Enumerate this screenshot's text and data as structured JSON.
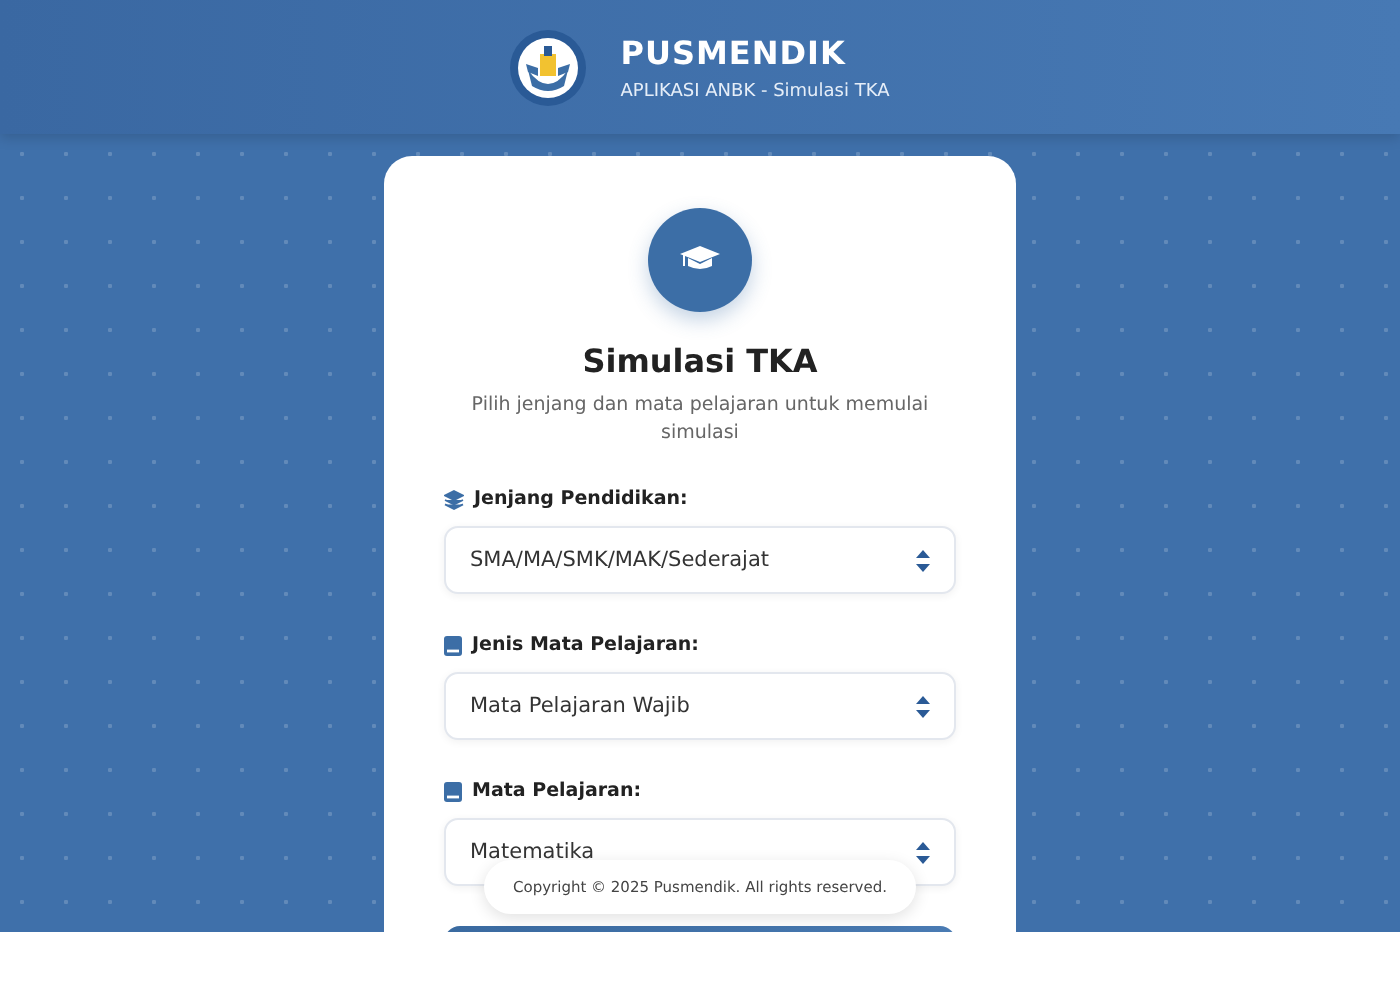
{
  "header": {
    "title": "PUSMENDIK",
    "subtitle": "APLIKASI ANBK - Simulasi TKA"
  },
  "card": {
    "title": "Simulasi TKA",
    "description": "Pilih jenjang dan mata pelajaran untuk memulai simulasi",
    "fields": [
      {
        "kind": "layers",
        "label": "Jenjang Pendidikan:",
        "value": "SMA/MA/SMK/MAK/Sederajat"
      },
      {
        "kind": "book",
        "label": "Jenis Mata Pelajaran:",
        "value": "Mata Pelajaran Wajib"
      },
      {
        "kind": "book",
        "label": "Mata Pelajaran:",
        "value": "Matematika"
      }
    ]
  },
  "footer": {
    "copyright": "Copyright © 2025 Pusmendik. All rights reserved."
  }
}
